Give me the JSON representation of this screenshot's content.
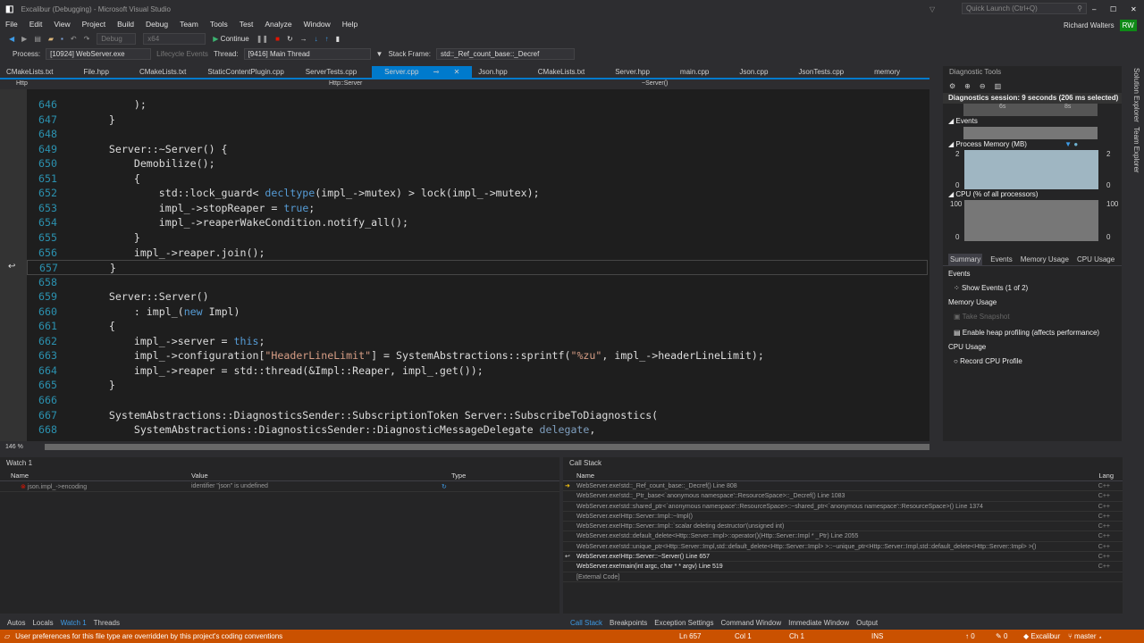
{
  "window": {
    "title": "Excalibur (Debugging) - Microsoft Visual Studio",
    "quick_launch": "Quick Launch (Ctrl+Q)",
    "user": "Richard Walters",
    "user_initials": "RW"
  },
  "menu": [
    "File",
    "Edit",
    "View",
    "Project",
    "Build",
    "Debug",
    "Team",
    "Tools",
    "Test",
    "Analyze",
    "Window",
    "Help"
  ],
  "toolbar": {
    "config": "Debug",
    "platform": "x64",
    "continue": "Continue"
  },
  "procbar": {
    "process_label": "Process:",
    "process": "[10924] WebServer.exe",
    "lifecycle": "Lifecycle Events",
    "thread_label": "Thread:",
    "thread": "[9416] Main Thread",
    "frame_label": "Stack Frame:",
    "frame": "std::_Ref_count_base::_Decref"
  },
  "tabs": [
    "CMakeLists.txt",
    "File.hpp",
    "CMakeLists.txt",
    "StaticContentPlugin.cpp",
    "ServerTests.cpp",
    "Server.cpp",
    "Json.hpp",
    "CMakeLists.txt",
    "Server.hpp",
    "main.cpp",
    "Json.cpp",
    "JsonTests.cpp",
    "memory"
  ],
  "nav": {
    "project": "Http",
    "scope": "Http::Server",
    "member": "~Server()"
  },
  "code": [
    {
      "n": "646",
      "t": [
        [
          "        );",
          ""
        ]
      ]
    },
    {
      "n": "647",
      "t": [
        [
          "    }",
          ""
        ]
      ]
    },
    {
      "n": "648",
      "t": [
        [
          "",
          ""
        ]
      ]
    },
    {
      "n": "649",
      "t": [
        [
          "    Server::~Server() {",
          ""
        ]
      ]
    },
    {
      "n": "650",
      "t": [
        [
          "        Demobilize();",
          ""
        ]
      ]
    },
    {
      "n": "651",
      "t": [
        [
          "        {",
          ""
        ]
      ]
    },
    {
      "n": "652",
      "t": [
        [
          "            std::lock_guard< ",
          ""
        ],
        [
          "decltype",
          "kw"
        ],
        [
          "(impl_->mutex) > lock(impl_->mutex);",
          ""
        ]
      ]
    },
    {
      "n": "653",
      "t": [
        [
          "            impl_->stopReaper = ",
          ""
        ],
        [
          "true",
          "kw"
        ],
        [
          ";",
          ""
        ]
      ]
    },
    {
      "n": "654",
      "t": [
        [
          "            impl_->reaperWakeCondition.notify_all();",
          ""
        ]
      ]
    },
    {
      "n": "655",
      "t": [
        [
          "        }",
          ""
        ]
      ]
    },
    {
      "n": "656",
      "t": [
        [
          "        impl_->reaper.join();",
          ""
        ]
      ]
    },
    {
      "n": "657",
      "t": [
        [
          "    }",
          ""
        ]
      ]
    },
    {
      "n": "658",
      "t": [
        [
          "",
          ""
        ]
      ]
    },
    {
      "n": "659",
      "t": [
        [
          "    Server::Server()",
          ""
        ]
      ]
    },
    {
      "n": "660",
      "t": [
        [
          "        : impl_(",
          ""
        ],
        [
          "new",
          "kw"
        ],
        [
          " Impl)",
          ""
        ]
      ]
    },
    {
      "n": "661",
      "t": [
        [
          "    {",
          ""
        ]
      ]
    },
    {
      "n": "662",
      "t": [
        [
          "        impl_->server = ",
          ""
        ],
        [
          "this",
          "kw"
        ],
        [
          ";",
          ""
        ]
      ]
    },
    {
      "n": "663",
      "t": [
        [
          "        impl_->configuration[",
          ""
        ],
        [
          "\"HeaderLineLimit\"",
          "str"
        ],
        [
          "] = SystemAbstractions::sprintf(",
          ""
        ],
        [
          "\"%zu\"",
          "str"
        ],
        [
          ", impl_->headerLineLimit);",
          ""
        ]
      ]
    },
    {
      "n": "664",
      "t": [
        [
          "        impl_->reaper = std::thread(&Impl::Reaper, impl_.get());",
          ""
        ]
      ]
    },
    {
      "n": "665",
      "t": [
        [
          "    }",
          ""
        ]
      ]
    },
    {
      "n": "666",
      "t": [
        [
          "",
          ""
        ]
      ]
    },
    {
      "n": "667",
      "t": [
        [
          "    SystemAbstractions::DiagnosticsSender::SubscriptionToken Server::SubscribeToDiagnostics(",
          ""
        ]
      ]
    },
    {
      "n": "668",
      "t": [
        [
          "        SystemAbstractions::DiagnosticsSender::DiagnosticMessageDelegate ",
          ""
        ],
        [
          "delegate",
          "par"
        ],
        [
          ",",
          ""
        ]
      ]
    }
  ],
  "zoom": "146 %",
  "watch": {
    "title": "Watch 1",
    "cols": [
      "Name",
      "Value",
      "Type"
    ],
    "rows": [
      {
        "name": "json.impl_->encoding",
        "value": "identifier \"json\" is undefined",
        "type": ""
      }
    ],
    "tabs": [
      "Autos",
      "Locals",
      "Watch 1",
      "Threads"
    ]
  },
  "callstack": {
    "title": "Call Stack",
    "cols": [
      "Name",
      "Lang"
    ],
    "rows": [
      {
        "name": "WebServer.exe!std::_Ref_count_base::_Decref() Line 808",
        "lang": "C++"
      },
      {
        "name": "WebServer.exe!std::_Ptr_base<`anonymous namespace'::ResourceSpace>::_Decref() Line 1083",
        "lang": "C++"
      },
      {
        "name": "WebServer.exe!std::shared_ptr<`anonymous namespace'::ResourceSpace>::~shared_ptr<`anonymous namespace'::ResourceSpace>() Line 1374",
        "lang": "C++"
      },
      {
        "name": "WebServer.exe!Http::Server::Impl::~Impl()",
        "lang": "C++"
      },
      {
        "name": "WebServer.exe!Http::Server::Impl::`scalar deleting destructor'(unsigned int)",
        "lang": "C++"
      },
      {
        "name": "WebServer.exe!std::default_delete<Http::Server::Impl>::operator()(Http::Server::Impl * _Ptr) Line 2055",
        "lang": "C++"
      },
      {
        "name": "WebServer.exe!std::unique_ptr<Http::Server::Impl,std::default_delete<Http::Server::Impl> >::~unique_ptr<Http::Server::Impl,std::default_delete<Http::Server::Impl> >()",
        "lang": "C++"
      },
      {
        "name": "WebServer.exe!Http::Server::~Server() Line 657",
        "lang": "C++"
      },
      {
        "name": "WebServer.exe!main(int argc, char * * argv) Line 519",
        "lang": "C++"
      },
      {
        "name": "[External Code]",
        "lang": ""
      }
    ],
    "tabs": [
      "Call Stack",
      "Breakpoints",
      "Exception Settings",
      "Command Window",
      "Immediate Window",
      "Output"
    ]
  },
  "diag": {
    "title": "Diagnostic Tools",
    "session": "Diagnostics session: 9 seconds (206 ms selected)",
    "ticks": [
      "6s",
      "8s"
    ],
    "events": "Events",
    "memory": "Process Memory (MB)",
    "mem_max": "2",
    "mem_min": "0",
    "cpu": "CPU (% of all processors)",
    "cpu_max": "100",
    "cpu_min": "0",
    "tabs": [
      "Summary",
      "Events",
      "Memory Usage",
      "CPU Usage"
    ],
    "sec_events": "Events",
    "show_events": "Show Events (1 of 2)",
    "sec_memory": "Memory Usage",
    "snapshot": "Take Snapshot",
    "heap": "Enable heap profiling (affects performance)",
    "sec_cpu": "CPU Usage",
    "record_cpu": "Record CPU Profile"
  },
  "side": [
    "Solution Explorer",
    "Team Explorer"
  ],
  "status": {
    "message": "User preferences for this file type are overridden by this project's coding conventions",
    "ln": "Ln 657",
    "col": "Col 1",
    "ch": "Ch 1",
    "mode": "INS",
    "up": "0",
    "edits": "0",
    "repo": "Excalibur",
    "branch": "master"
  },
  "colors": {
    "accent": "#007acc",
    "status": "#ca5100",
    "editor_bg": "#1e1e1e"
  }
}
